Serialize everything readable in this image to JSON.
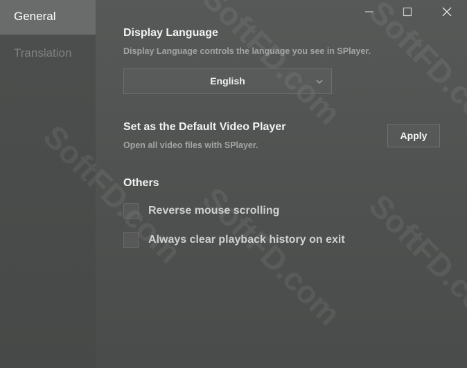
{
  "sidebar": {
    "items": [
      {
        "label": "General",
        "active": true
      },
      {
        "label": "Translation",
        "active": false
      }
    ]
  },
  "window_controls": {
    "minimize_icon": "minimize-icon",
    "maximize_icon": "maximize-icon",
    "close_icon": "close-icon"
  },
  "display_language": {
    "title": "Display Language",
    "description": "Display Language controls the language you see in SPlayer.",
    "selected": "English"
  },
  "default_player": {
    "title": "Set as the Default Video Player",
    "description": "Open all video files with SPlayer.",
    "button_label": "Apply"
  },
  "others": {
    "title": "Others",
    "options": [
      {
        "label": "Reverse mouse scrolling",
        "checked": false
      },
      {
        "label": "Always clear playback history on exit",
        "checked": false
      }
    ]
  },
  "watermark": "SoftFD.com",
  "colors": {
    "background": "#525453",
    "sidebar": "#4a4c4b",
    "active_nav": "#6a6c6b",
    "heading_text": "#f2f2f2",
    "muted_text": "#a3a5a4"
  }
}
